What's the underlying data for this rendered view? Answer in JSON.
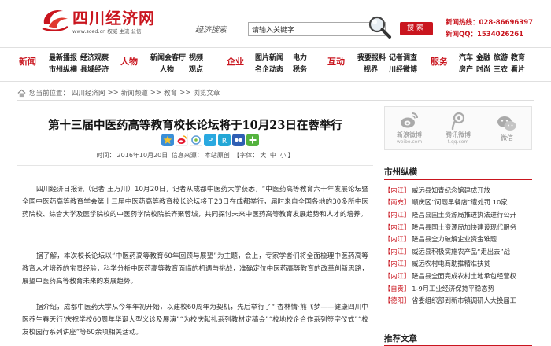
{
  "header": {
    "site_name": "四川经济网",
    "tagline": "www.sced.cn  权威 主流 公信",
    "search_logo": "经济搜索",
    "search_placeholder": "请输入关键字",
    "search_button": "搜索",
    "hotlines": [
      "新闻热线：028-86696397",
      "新闻QQ：1534026261"
    ]
  },
  "nav": [
    {
      "category": "新闻",
      "links": [
        "最新播报",
        "经济观察",
        "市州纵横",
        "县域经济"
      ]
    },
    {
      "category": "人物",
      "links": [
        "新闻会客厅",
        "视频",
        "人物",
        "观点"
      ]
    },
    {
      "category": "企业",
      "links": [
        "图片新闻",
        "电力",
        "名企动态",
        "税务"
      ]
    },
    {
      "category": "互动",
      "links": [
        "我要报料",
        "记者调查",
        "视界",
        "川经微博"
      ]
    },
    {
      "category": "服务",
      "links": [
        "汽车",
        "金融",
        "旅游",
        "教育",
        "房产",
        "时尚",
        "三农",
        "看片"
      ]
    }
  ],
  "breadcrumb": {
    "label": "您当前位置：",
    "items": [
      "四川经济网",
      "新闻频道",
      "教育",
      "浏览文章"
    ],
    "separator": ">>"
  },
  "article": {
    "title": "第十三届中医药高等教育校长论坛将于10月23日在蓉举行",
    "meta": {
      "time_label": "时间：",
      "time": "2016年10月20日",
      "source_label": "信息来源：",
      "source": "本站原创",
      "font_label": "【字体：",
      "font_options": [
        "大",
        "中",
        "小"
      ],
      "font_end": "】"
    },
    "paragraphs": [
      "四川经济日报讯（记者 王万川）10月20日，记者从成都中医药大学获悉，“中医药高等教育六十年发展论坛暨全国中医药高等教育学会第十三届中医药高等教育校长论坛将于23日在成都举行，届时来自全国各地的30多所中医药院校、综合大学及医学院校的中医药学院校院长齐聚蓉城，共同探讨未来中医药高等教育发展趋势和人才的培养。",
      "据了解，本次校长论坛以“中医药高等教育60年回顾与展望”为主题，会上，专家学者们将全面梳理中医药高等教育人才培养的宝贵经验，科学分析中医药高等教育面临的机遇与挑战，准确定位中医药高等教育的改革创新思路，展望中医药高等教育未来的发展趋势。",
      "据介绍，成都中医药大学从今年年初开始，以建校60周年为契机，先后举行了“‘杏林情·熊飞梦——健康四川中医养生春天行’庆祝学校60周年华诞大型义诊及展演”“为校庆献礼系列教材定稿会”“校地校企合作系列签字仪式”“校友校园行系列讲座”等60余项相关活动。"
    ]
  },
  "sidebar": {
    "social": [
      {
        "label": "新浪微博",
        "sub": "weibo.com",
        "color": "#999999"
      },
      {
        "label": "腾讯微博",
        "sub": "t.qq.com",
        "color": "#999999"
      },
      {
        "label": "微信",
        "sub": "",
        "color": "#999999"
      }
    ],
    "section_title": "市州纵横",
    "news": [
      {
        "tag": "【内江】",
        "text": "威远县知青纪念馆建成开放"
      },
      {
        "tag": "【南充】",
        "text": "顺庆区“问题早餐店”遭处罚  10家"
      },
      {
        "tag": "【内江】",
        "text": "隆昌县国土资源局推进执法进行公开"
      },
      {
        "tag": "【内江】",
        "text": "隆昌县国土资源局加快建设现代服务"
      },
      {
        "tag": "【内江】",
        "text": "隆昌县全力破解企业资金难题"
      },
      {
        "tag": "【内江】",
        "text": "威远县积极实施农产品“走出去”战"
      },
      {
        "tag": "【内江】",
        "text": "威远农村电商助推精准扶贫"
      },
      {
        "tag": "【内江】",
        "text": "隆昌县全面完成农村土地承包经营权"
      },
      {
        "tag": "【自贡】",
        "text": "1-9月工业经济保持平稳态势"
      },
      {
        "tag": "【德阳】",
        "text": "省委组织部到新市镇调研人大换届工"
      }
    ],
    "recommend_title": "推荐文章"
  },
  "colors": {
    "brand_red": "#c9151e"
  }
}
